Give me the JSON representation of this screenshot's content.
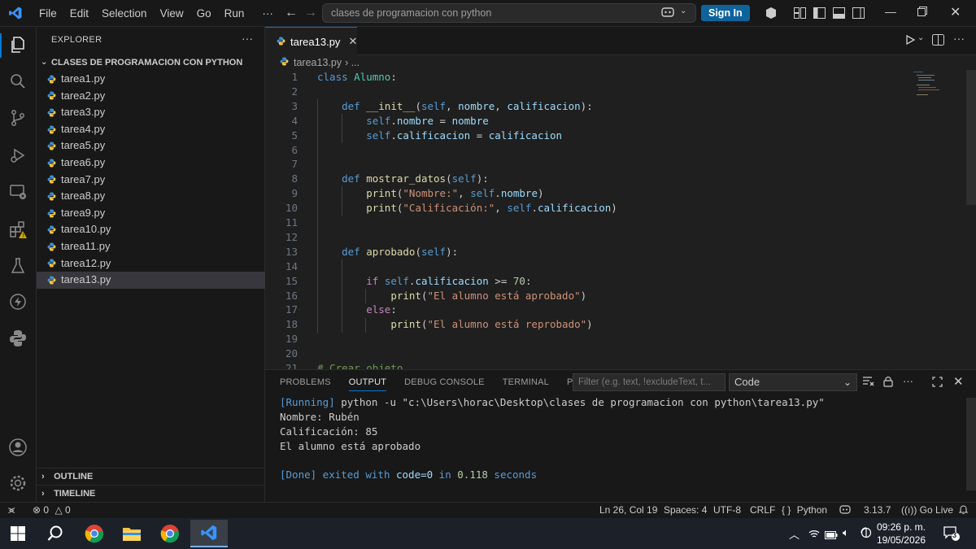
{
  "titlebar": {
    "menu": [
      "File",
      "Edit",
      "Selection",
      "View",
      "Go",
      "Run",
      "···"
    ],
    "search": "clases de programacion con python",
    "signin": "Sign In"
  },
  "activitybar": {
    "icons": [
      "explorer-icon",
      "search-icon",
      "source-control-icon",
      "run-debug-icon",
      "remote-explorer-icon",
      "extensions-icon",
      "testing-icon",
      "thunder-icon",
      "python-icon",
      "accounts-icon",
      "settings-icon"
    ]
  },
  "sidebar": {
    "title": "EXPLORER",
    "more": "···",
    "folder": "CLASES DE PROGRAMACION CON PYTHON",
    "files": [
      "tarea1.py",
      "tarea2.py",
      "tarea3.py",
      "tarea4.py",
      "tarea5.py",
      "tarea6.py",
      "tarea7.py",
      "tarea8.py",
      "tarea9.py",
      "tarea10.py",
      "tarea11.py",
      "tarea12.py",
      "tarea13.py"
    ],
    "active_file": "tarea13.py",
    "outline": "OUTLINE",
    "timeline": "TIMELINE"
  },
  "editor": {
    "tab_label": "tarea13.py",
    "breadcrumb_file": "tarea13.py",
    "breadcrumb_rest": "› ...",
    "line_numbers": [
      "1",
      "2",
      "3",
      "4",
      "5",
      "6",
      "7",
      "8",
      "9",
      "10",
      "11",
      "12",
      "13",
      "14",
      "15",
      "16",
      "17",
      "18",
      "19",
      "20",
      "21"
    ],
    "code_lines": [
      "class Alumno:",
      "",
      "    def __init__(self, nombre, calificacion):",
      "        self.nombre = nombre",
      "        self.calificacion = calificacion",
      "",
      "",
      "    def mostrar_datos(self):",
      "        print(\"Nombre:\", self.nombre)",
      "        print(\"Calificación:\", self.calificacion)",
      "",
      "",
      "    def aprobado(self):",
      "",
      "        if self.calificacion >= 70:",
      "            print(\"El alumno está aprobado\")",
      "        else:",
      "            print(\"El alumno está reprobado\")",
      "",
      "",
      "# Crear objeto"
    ]
  },
  "panel": {
    "tabs": [
      "PROBLEMS",
      "OUTPUT",
      "DEBUG CONSOLE",
      "TERMINAL",
      "PORTS"
    ],
    "active_tab": "OUTPUT",
    "filter_placeholder": "Filter (e.g. text, !excludeText, t...",
    "channel": "Code",
    "output": {
      "running_tag": "[Running]",
      "running_cmd": " python -u \"c:\\Users\\horac\\Desktop\\clases de programacion con python\\tarea13.py\"",
      "line1": "Nombre: Rubén",
      "line2": "Calificación: 85",
      "line3": "El alumno está aprobado",
      "done_tag": "[Done]",
      "done_text_a": " exited with ",
      "done_code": "code=0",
      "done_text_b": " in ",
      "done_time": "0.118",
      "done_text_c": " seconds"
    }
  },
  "statusbar": {
    "errors": "0",
    "warnings": "0",
    "position": "Ln 26, Col 19",
    "spaces": "Spaces: 4",
    "encoding": "UTF-8",
    "eol": "CRLF",
    "language": "Python",
    "python_version": "3.13.7",
    "golive": "Go Live"
  },
  "taskbar": {
    "time": "09:26 p. m.",
    "date": "19/05/2026",
    "notifications": "3"
  },
  "colors": {
    "accent": "#0078d4",
    "signin": "#0e639c",
    "keyword": "#569cd6",
    "control": "#c586c0",
    "function": "#dcdcaa",
    "string": "#ce9178"
  }
}
